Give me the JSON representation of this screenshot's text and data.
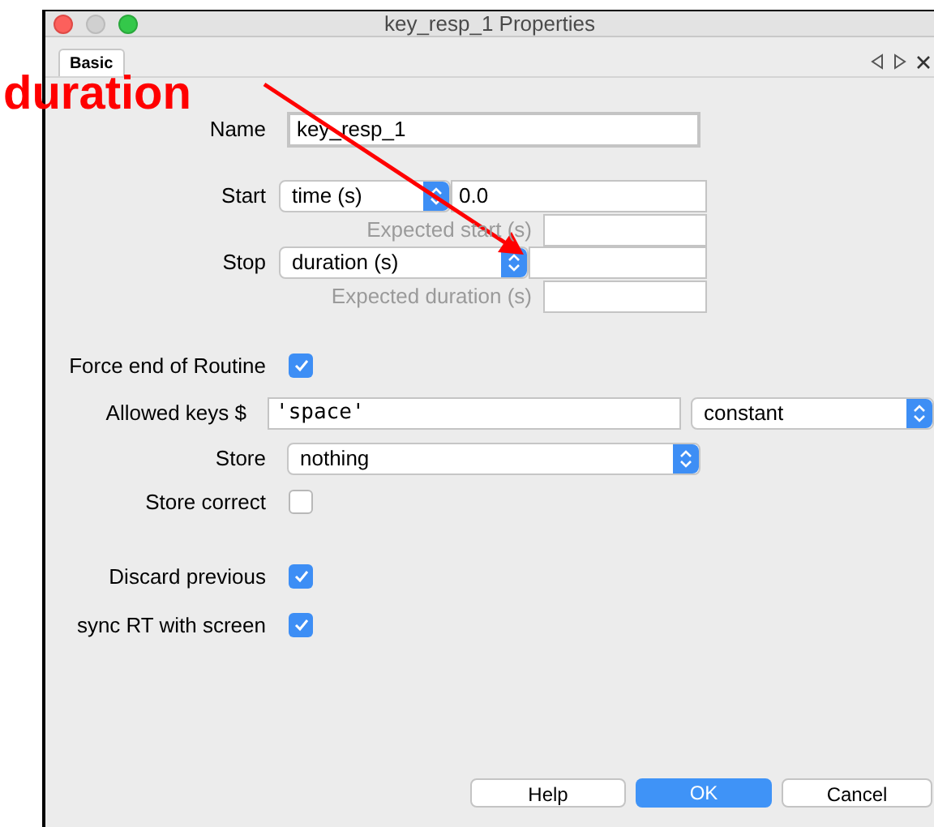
{
  "window": {
    "title": "key_resp_1 Properties"
  },
  "tabs": [
    {
      "label": "Basic",
      "selected": true
    }
  ],
  "annotation": {
    "text": "duration"
  },
  "rows": [
    {
      "kind": "text",
      "label": "Name",
      "value": "key_resp_1",
      "focused": true
    },
    {
      "kind": "select_text",
      "label": "Start",
      "option": "time (s)",
      "value": "0.0"
    },
    {
      "kind": "sub_field",
      "label": "Expected start (s)"
    },
    {
      "kind": "select_text",
      "label": "Stop",
      "option": "duration (s)"
    },
    {
      "kind": "sub_field",
      "label": "Expected duration (s)"
    },
    {
      "kind": "checkbox",
      "label": "Force end of Routine",
      "checked": true
    },
    {
      "kind": "text_select",
      "label": "Allowed keys $",
      "value": "'space'",
      "option": "constant"
    },
    {
      "kind": "select",
      "label": "Store",
      "option": "nothing"
    },
    {
      "kind": "checkbox",
      "label": "Store correct",
      "checked": false
    },
    {
      "kind": "checkbox",
      "label": "Discard previous",
      "checked": true
    },
    {
      "kind": "checkbox",
      "label": "sync RT with screen",
      "checked": true
    }
  ],
  "buttons": [
    {
      "label": "Help",
      "default": false
    },
    {
      "label": "OK",
      "default": true
    },
    {
      "label": "Cancel",
      "default": false
    }
  ]
}
